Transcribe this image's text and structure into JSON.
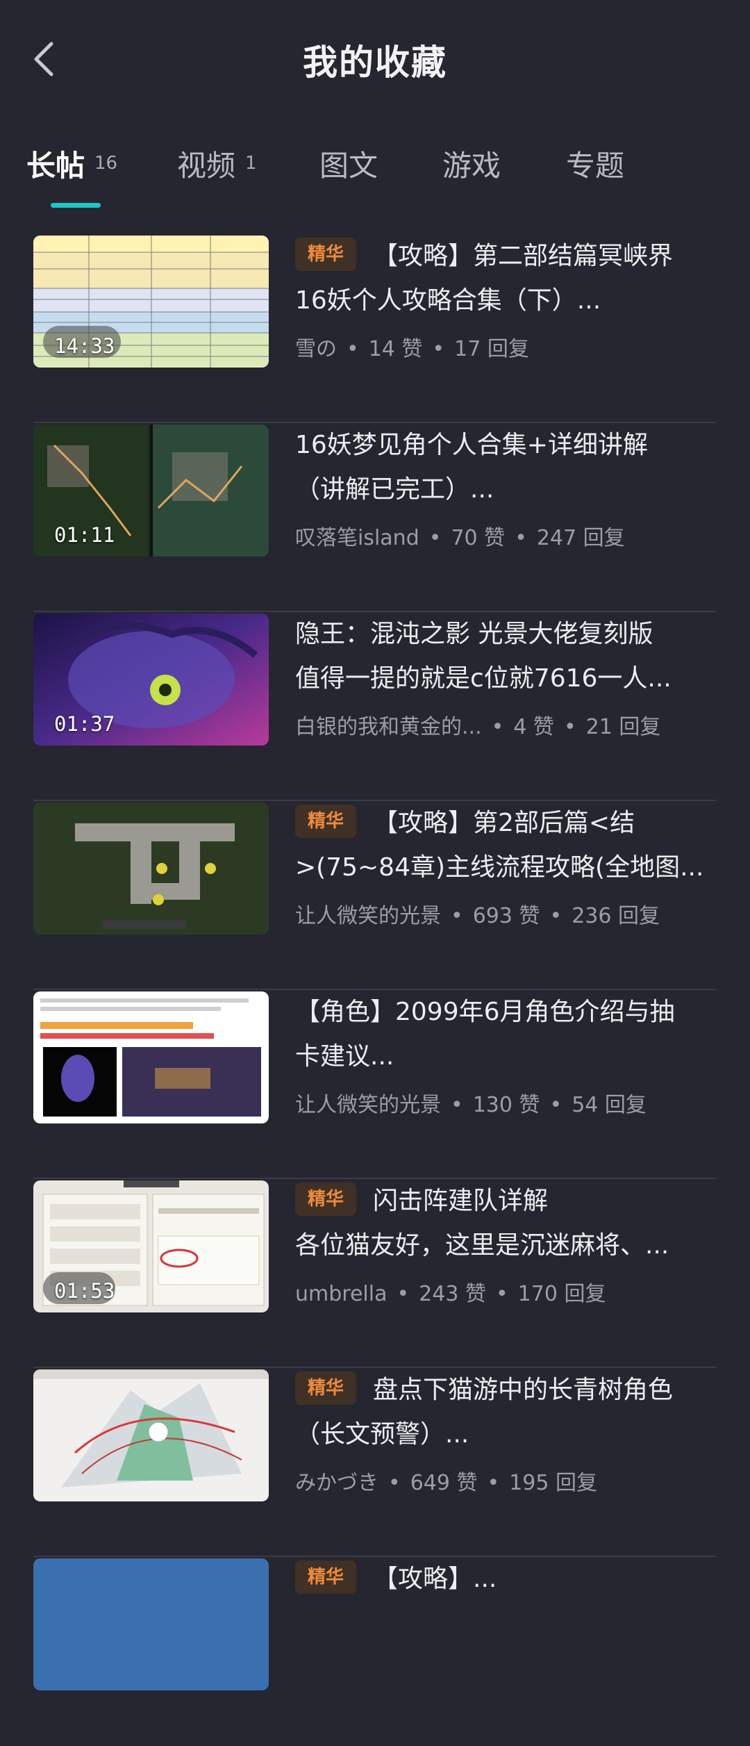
{
  "header": {
    "title": "我的收藏"
  },
  "tabs": [
    {
      "label": "长帖",
      "count": "16"
    },
    {
      "label": "视频",
      "count": "1"
    },
    {
      "label": "图文",
      "count": ""
    },
    {
      "label": "游戏",
      "count": ""
    },
    {
      "label": "专题",
      "count": ""
    }
  ],
  "posts": [
    {
      "badge": "精华",
      "title1": "【攻略】第二部结篇冥峡界",
      "title2": "16妖个人攻略合集（下）...",
      "author": "雪の",
      "likes": "14 赞",
      "replies": "17 回复",
      "duration": "14:33"
    },
    {
      "badge": "",
      "title1": "16妖梦见角个人合集+详细讲解",
      "title2": "（讲解已完工）...",
      "author": "叹落笔island",
      "likes": "70 赞",
      "replies": "247 回复",
      "duration": "01:11"
    },
    {
      "badge": "",
      "title1": "隐王：混沌之影 光景大佬复刻版",
      "title2": "值得一提的就是c位就7616一人...",
      "author": "白银的我和黄金的...",
      "likes": "4 赞",
      "replies": "21 回复",
      "duration": "01:37"
    },
    {
      "badge": "精华",
      "title1": "【攻略】第2部后篇<结",
      "title2": ">(75~84章)主线流程攻略(全地图...",
      "author": "让人微笑的光景",
      "likes": "693 赞",
      "replies": "236 回复",
      "duration": ""
    },
    {
      "badge": "",
      "title1": "【角色】2099年6月角色介绍与抽",
      "title2": "卡建议...",
      "author": "让人微笑的光景",
      "likes": "130 赞",
      "replies": "54 回复",
      "duration": ""
    },
    {
      "badge": "精华",
      "title1": "闪击阵建队详解",
      "title2": "各位猫友好，这里是沉迷麻将、...",
      "author": "umbrella",
      "likes": "243 赞",
      "replies": "170 回复",
      "duration": "01:53"
    },
    {
      "badge": "精华",
      "title1": "盘点下猫游中的长青树角色",
      "title2": "（长文预警）...",
      "author": "みかづき",
      "likes": "649 赞",
      "replies": "195 回复",
      "duration": ""
    },
    {
      "badge": "精华",
      "title1": "【攻略】...",
      "title2": "",
      "author": "",
      "likes": "",
      "replies": "",
      "duration": ""
    }
  ],
  "colors": {
    "background": "#25262f",
    "accent": "#22c3c7",
    "badge_text": "#f08a3b",
    "badge_bg": "#3f3125"
  },
  "icons": {
    "back": "chevron-left-icon"
  }
}
